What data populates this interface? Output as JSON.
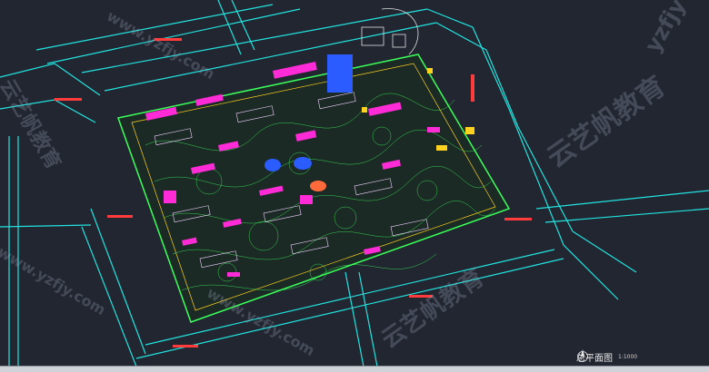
{
  "drawing": {
    "title": "总平面图",
    "scale": "1:1000"
  },
  "watermarks": {
    "brand": "云艺帆教育",
    "url": "www.yzfjy.com",
    "short": "yzfjy"
  },
  "colors": {
    "background": "#212630",
    "road": "#22e3e0",
    "building": "#ff2bd6",
    "landscape": "#3bff5a",
    "label": "#ff3b3b",
    "water": "#2a5cff",
    "accent": "#ffd21f"
  },
  "icons": {
    "north_arrow": "north-arrow-icon"
  }
}
